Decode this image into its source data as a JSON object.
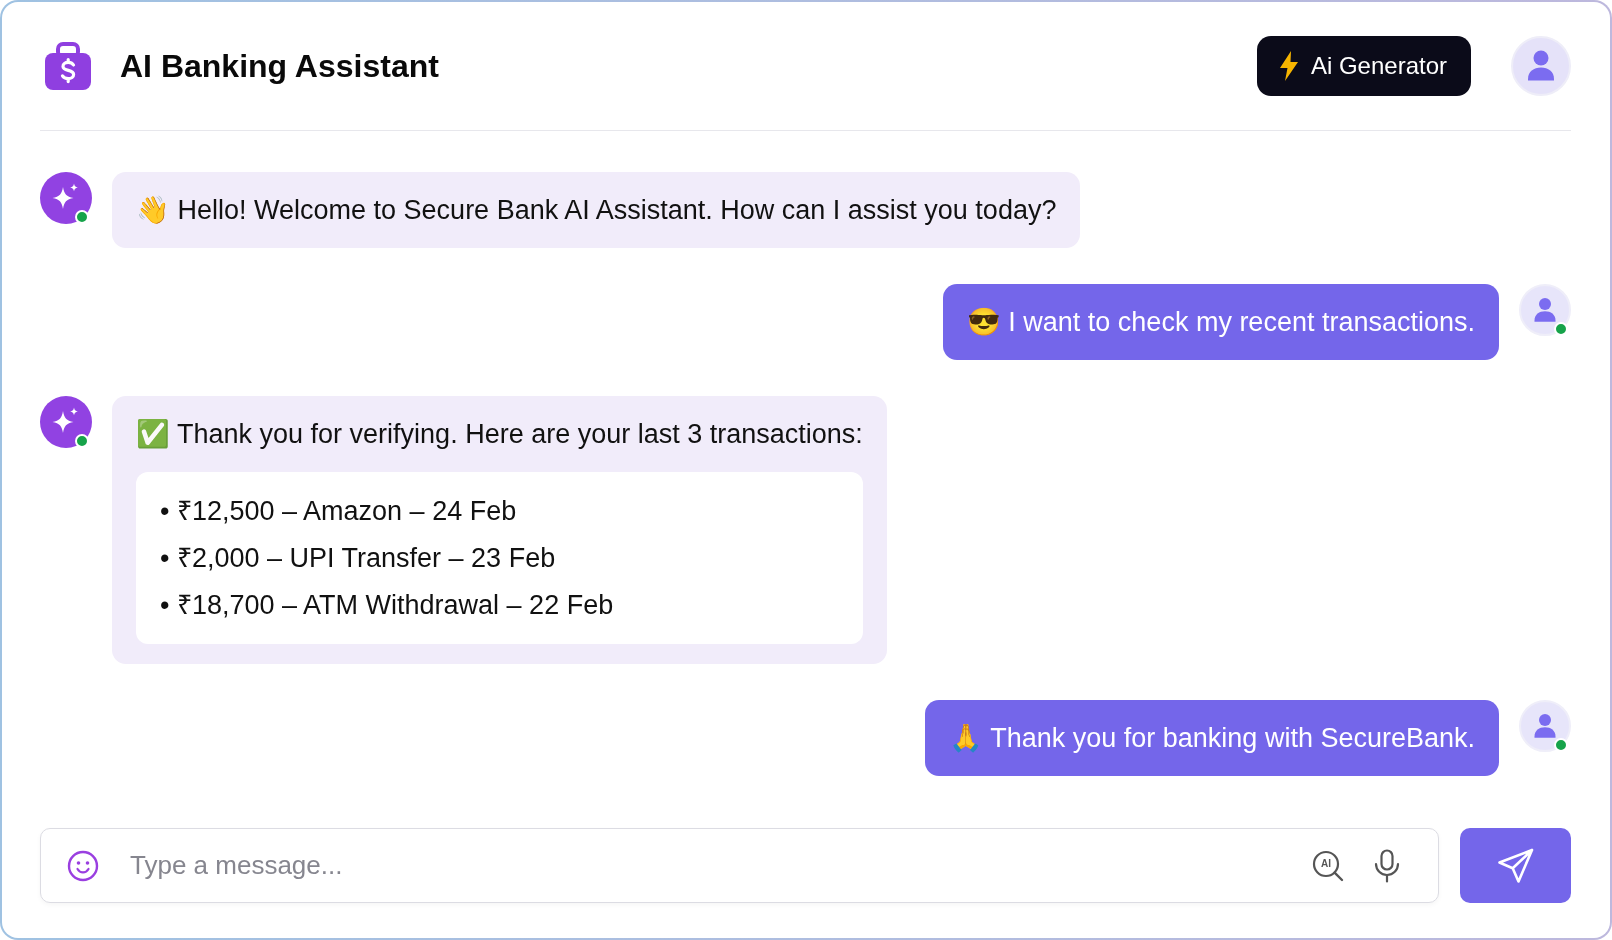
{
  "header": {
    "title": "AI Banking Assistant",
    "generator_button": {
      "label": "Ai Generator"
    }
  },
  "messages": [
    {
      "kind": "bot",
      "online": true,
      "text": "👋 Hello! Welcome to Secure Bank AI Assistant. How can I assist you today?"
    },
    {
      "kind": "user",
      "online": true,
      "text": "😎 I want to check my recent transactions."
    },
    {
      "kind": "bot",
      "online": true,
      "text": "✅ Thank you for verifying. Here are your last 3 transactions:",
      "list": [
        "• ₹12,500 – Amazon – 24 Feb",
        "• ₹2,000 – UPI Transfer – 23 Feb",
        "• ₹18,700 – ATM Withdrawal – 22 Feb"
      ]
    },
    {
      "kind": "user",
      "online": true,
      "text": "🙏 Thank you for banking with SecureBank."
    }
  ],
  "composer": {
    "placeholder": "Type a message...",
    "ai_button_label": "AI"
  }
}
